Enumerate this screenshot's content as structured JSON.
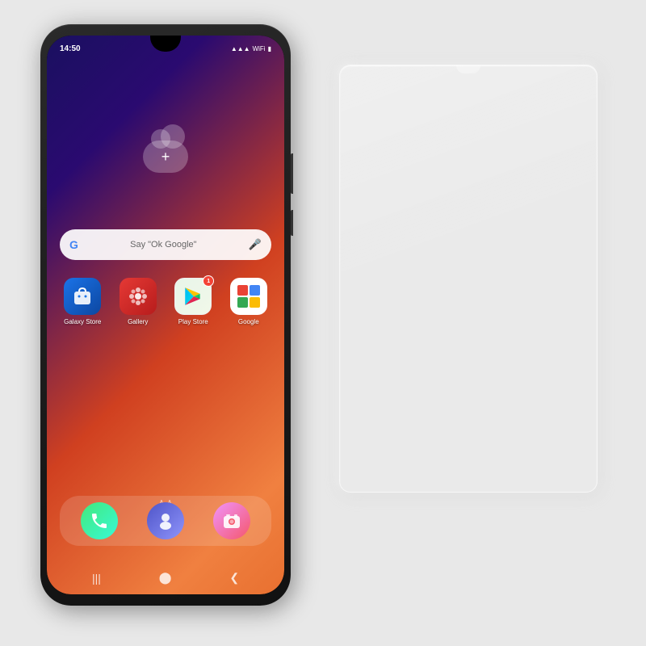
{
  "page": {
    "background": "#e8e8e8"
  },
  "phone": {
    "status_bar": {
      "time": "14:50",
      "icons": [
        "battery",
        "signal",
        "wifi"
      ]
    },
    "search_bar": {
      "google_label": "G",
      "placeholder": "Say \"Ok Google\"",
      "mic_symbol": "🎤"
    },
    "apps": [
      {
        "id": "galaxy-store",
        "label": "Galaxy Store",
        "color": "#1a73e8"
      },
      {
        "id": "gallery",
        "label": "Gallery",
        "color": "#e53935"
      },
      {
        "id": "play-store",
        "label": "Play Store",
        "badge": "1"
      },
      {
        "id": "google",
        "label": "Google"
      }
    ],
    "dock": [
      {
        "id": "phone",
        "label": "Phone"
      },
      {
        "id": "bixby",
        "label": "Bixby"
      },
      {
        "id": "camera",
        "label": "Camera"
      }
    ],
    "nav": {
      "back": "❮",
      "home": "⬤",
      "recent": "|||"
    }
  }
}
